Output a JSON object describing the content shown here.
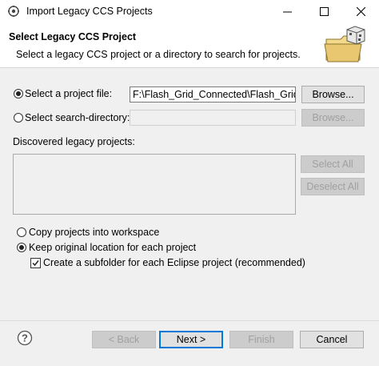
{
  "window": {
    "title": "Import Legacy CCS Projects",
    "minimize": "—",
    "maximize": "☐",
    "close": "✕"
  },
  "banner": {
    "title": "Select Legacy CCS Project",
    "description": "Select a legacy CCS project or a directory to search for projects."
  },
  "source": {
    "project_file_label": "Select a project file:",
    "project_file_value": "F:\\Flash_Grid_Connected\\Flash_Grid_Cc",
    "browse_label": "Browse...",
    "search_dir_label": "Select search-directory:",
    "search_dir_value": "",
    "browse2_label": "Browse..."
  },
  "discovered": {
    "label": "Discovered legacy projects:",
    "select_all": "Select All",
    "deselect_all": "Deselect All"
  },
  "options": {
    "copy_label": "Copy projects into workspace",
    "keep_label": "Keep original location for each project",
    "subfolder_label": "Create a subfolder for each Eclipse project (recommended)"
  },
  "footer": {
    "back": "< Back",
    "next": "Next >",
    "finish": "Finish",
    "cancel": "Cancel"
  },
  "icons": {
    "app": "gear-cube-icon",
    "banner": "folder-cube-icon",
    "help": "help-icon"
  },
  "colors": {
    "accent": "#0078d7",
    "dialog_bg": "#f0f0f0"
  }
}
